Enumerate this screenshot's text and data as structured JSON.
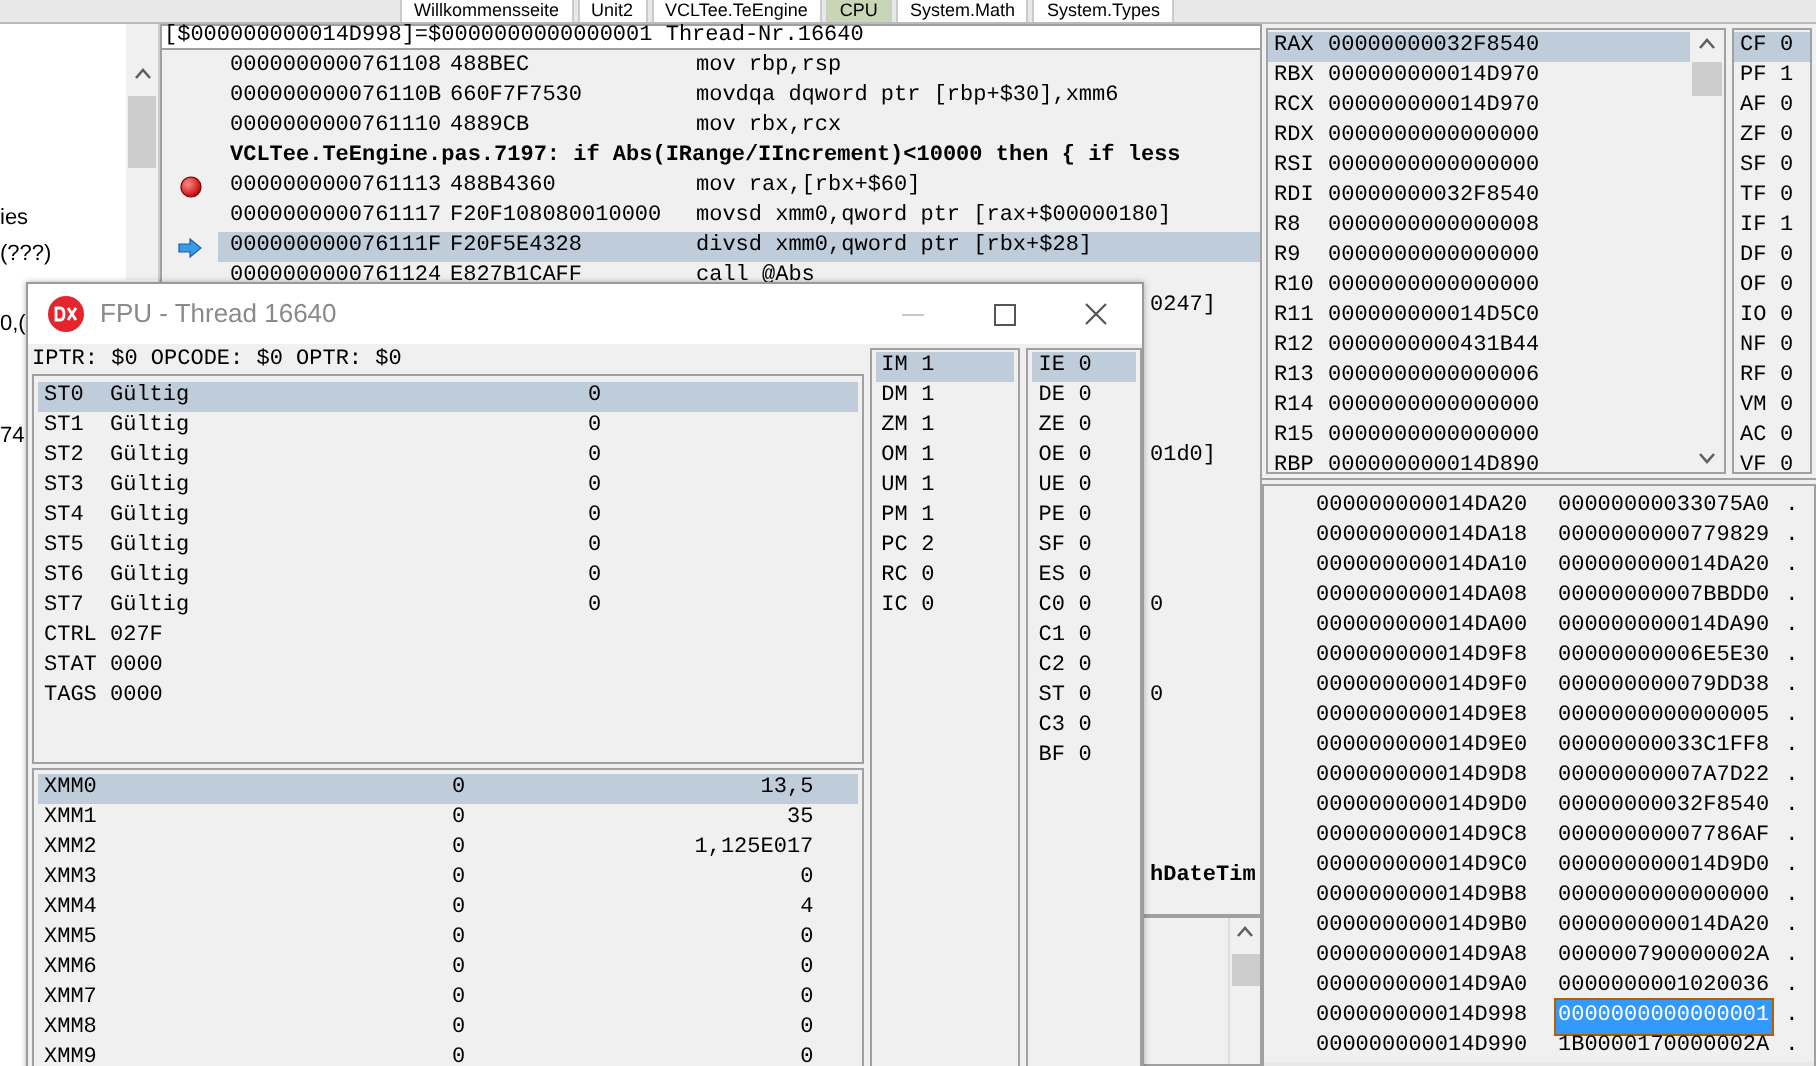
{
  "ide_tabs": [
    {
      "label": "Willkommensseite",
      "selected": false
    },
    {
      "label": "Unit2",
      "selected": false
    },
    {
      "label": "VCLTee.TeEngine",
      "selected": false
    },
    {
      "label": "CPU",
      "selected": true
    },
    {
      "label": "System.Math",
      "selected": false
    },
    {
      "label": "System.Types",
      "selected": false
    }
  ],
  "left_panel": {
    "fragments": [
      "ies",
      "(???)",
      "0,(",
      "74"
    ]
  },
  "disassembly": {
    "header": "[$000000000014D998]=$0000000000000001 Thread-Nr.16640",
    "rows": [
      {
        "kind": "code",
        "address": "0000000000761108",
        "bytes": "488BEC",
        "instruction": "mov rbp,rsp",
        "breakpoint": false,
        "current_line": false,
        "selected": false
      },
      {
        "kind": "code",
        "address": "000000000076110B",
        "bytes": "660F7F7530",
        "instruction": "movdqa dqword ptr [rbp+$30],xmm6",
        "breakpoint": false,
        "current_line": false,
        "selected": false
      },
      {
        "kind": "code",
        "address": "0000000000761110",
        "bytes": "4889CB",
        "instruction": "mov rbx,rcx",
        "breakpoint": false,
        "current_line": false,
        "selected": false
      },
      {
        "kind": "source",
        "text": "VCLTee.TeEngine.pas.7197: if Abs(IRange/IIncrement)<10000 then  { if less"
      },
      {
        "kind": "code",
        "address": "0000000000761113",
        "bytes": "488B4360",
        "instruction": "mov rax,[rbx+$60]",
        "breakpoint": true,
        "current_line": false,
        "selected": false
      },
      {
        "kind": "code",
        "address": "0000000000761117",
        "bytes": "F20F108080010000",
        "instruction": "movsd xmm0,qword ptr [rax+$00000180]",
        "breakpoint": false,
        "current_line": false,
        "selected": false
      },
      {
        "kind": "code",
        "address": "000000000076111F",
        "bytes": "F20F5E4328",
        "instruction": "divsd xmm0,qword ptr [rbx+$28]",
        "breakpoint": false,
        "current_line": true,
        "selected": true
      },
      {
        "kind": "code",
        "address": "0000000000761124",
        "bytes": "E827B1CAFF",
        "instruction": "call @Abs",
        "breakpoint": false,
        "current_line": false,
        "selected": false
      }
    ],
    "hidden_fragments": [
      {
        "kind": "code",
        "text": "0247]"
      },
      {
        "kind": "code",
        "text": "01d0]"
      },
      {
        "kind": "code",
        "text": "0"
      },
      {
        "kind": "code",
        "text": "0"
      },
      {
        "kind": "source",
        "text": "hDateTim"
      }
    ]
  },
  "registers": [
    {
      "name": "RAX",
      "value": "00000000032F8540",
      "selected": true
    },
    {
      "name": "RBX",
      "value": "000000000014D970",
      "selected": false
    },
    {
      "name": "RCX",
      "value": "000000000014D970",
      "selected": false
    },
    {
      "name": "RDX",
      "value": "0000000000000000",
      "selected": false
    },
    {
      "name": "RSI",
      "value": "0000000000000000",
      "selected": false
    },
    {
      "name": "RDI",
      "value": "00000000032F8540",
      "selected": false
    },
    {
      "name": "R8",
      "value": "0000000000000008",
      "selected": false
    },
    {
      "name": "R9",
      "value": "0000000000000000",
      "selected": false
    },
    {
      "name": "R10",
      "value": "0000000000000000",
      "selected": false
    },
    {
      "name": "R11",
      "value": "000000000014D5C0",
      "selected": false
    },
    {
      "name": "R12",
      "value": "0000000000431B44",
      "selected": false
    },
    {
      "name": "R13",
      "value": "0000000000000006",
      "selected": false
    },
    {
      "name": "R14",
      "value": "0000000000000000",
      "selected": false
    },
    {
      "name": "R15",
      "value": "0000000000000000",
      "selected": false
    },
    {
      "name": "RBP",
      "value": "000000000014D890",
      "selected": false
    }
  ],
  "flags": [
    {
      "name": "CF",
      "value": "0",
      "selected": true
    },
    {
      "name": "PF",
      "value": "1",
      "selected": false
    },
    {
      "name": "AF",
      "value": "0",
      "selected": false
    },
    {
      "name": "ZF",
      "value": "0",
      "selected": false
    },
    {
      "name": "SF",
      "value": "0",
      "selected": false
    },
    {
      "name": "TF",
      "value": "0",
      "selected": false
    },
    {
      "name": "IF",
      "value": "1",
      "selected": false
    },
    {
      "name": "DF",
      "value": "0",
      "selected": false
    },
    {
      "name": "OF",
      "value": "0",
      "selected": false
    },
    {
      "name": "IO",
      "value": "0",
      "selected": false
    },
    {
      "name": "NF",
      "value": "0",
      "selected": false
    },
    {
      "name": "RF",
      "value": "0",
      "selected": false
    },
    {
      "name": "VM",
      "value": "0",
      "selected": false
    },
    {
      "name": "AC",
      "value": "0",
      "selected": false
    },
    {
      "name": "VF",
      "value": "0",
      "selected": false
    }
  ],
  "stack": [
    {
      "address": "000000000014DA20",
      "value": "00000000033075A0",
      "ascii": ".",
      "selected": false
    },
    {
      "address": "000000000014DA18",
      "value": "0000000000779829",
      "ascii": ".",
      "selected": false
    },
    {
      "address": "000000000014DA10",
      "value": "000000000014DA20",
      "ascii": ".",
      "selected": false
    },
    {
      "address": "000000000014DA08",
      "value": "00000000007BBDD0",
      "ascii": ".",
      "selected": false
    },
    {
      "address": "000000000014DA00",
      "value": "000000000014DA90",
      "ascii": ".",
      "selected": false
    },
    {
      "address": "000000000014D9F8",
      "value": "00000000006E5E30",
      "ascii": ".",
      "selected": false
    },
    {
      "address": "000000000014D9F0",
      "value": "000000000079DD38",
      "ascii": ".",
      "selected": false
    },
    {
      "address": "000000000014D9E8",
      "value": "0000000000000005",
      "ascii": ".",
      "selected": false
    },
    {
      "address": "000000000014D9E0",
      "value": "00000000033C1FF8",
      "ascii": ".",
      "selected": false
    },
    {
      "address": "000000000014D9D8",
      "value": "00000000007A7D22",
      "ascii": ".",
      "selected": false
    },
    {
      "address": "000000000014D9D0",
      "value": "00000000032F8540",
      "ascii": ".",
      "selected": false
    },
    {
      "address": "000000000014D9C8",
      "value": "00000000007786AF",
      "ascii": ".",
      "selected": false
    },
    {
      "address": "000000000014D9C0",
      "value": "000000000014D9D0",
      "ascii": ".",
      "selected": false
    },
    {
      "address": "000000000014D9B8",
      "value": "0000000000000000",
      "ascii": ".",
      "selected": false
    },
    {
      "address": "000000000014D9B0",
      "value": "000000000014DA20",
      "ascii": ".",
      "selected": false
    },
    {
      "address": "000000000014D9A8",
      "value": "000000790000002A",
      "ascii": ".",
      "selected": false
    },
    {
      "address": "000000000014D9A0",
      "value": "0000000001020036",
      "ascii": ".",
      "selected": false
    },
    {
      "address": "000000000014D998",
      "value": "0000000000000001",
      "ascii": ".",
      "selected": true
    },
    {
      "address": "000000000014D990",
      "value": "1B0000170000002A",
      "ascii": ".",
      "selected": false
    }
  ],
  "fpu_window": {
    "title": "FPU - Thread 16640",
    "info": "IPTR: $0 OPCODE: $0 OPTR: $0",
    "st_registers": [
      {
        "name": "ST0",
        "status": "Gültig",
        "value": "0",
        "selected": true
      },
      {
        "name": "ST1",
        "status": "Gültig",
        "value": "0",
        "selected": false
      },
      {
        "name": "ST2",
        "status": "Gültig",
        "value": "0",
        "selected": false
      },
      {
        "name": "ST3",
        "status": "Gültig",
        "value": "0",
        "selected": false
      },
      {
        "name": "ST4",
        "status": "Gültig",
        "value": "0",
        "selected": false
      },
      {
        "name": "ST5",
        "status": "Gültig",
        "value": "0",
        "selected": false
      },
      {
        "name": "ST6",
        "status": "Gültig",
        "value": "0",
        "selected": false
      },
      {
        "name": "ST7",
        "status": "Gültig",
        "value": "0",
        "selected": false
      }
    ],
    "words": [
      {
        "name": "CTRL",
        "value": "027F"
      },
      {
        "name": "STAT",
        "value": "0000"
      },
      {
        "name": "TAGS",
        "value": "0000"
      }
    ],
    "xmm": [
      {
        "name": "XMM0",
        "column_2": "0",
        "column_3": "13,5",
        "selected": true
      },
      {
        "name": "XMM1",
        "column_2": "0",
        "column_3": "35",
        "selected": false
      },
      {
        "name": "XMM2",
        "column_2": "0",
        "column_3": "1,125E017",
        "selected": false
      },
      {
        "name": "XMM3",
        "column_2": "0",
        "column_3": "0",
        "selected": false
      },
      {
        "name": "XMM4",
        "column_2": "0",
        "column_3": "4",
        "selected": false
      },
      {
        "name": "XMM5",
        "column_2": "0",
        "column_3": "0",
        "selected": false
      },
      {
        "name": "XMM6",
        "column_2": "0",
        "column_3": "0",
        "selected": false
      },
      {
        "name": "XMM7",
        "column_2": "0",
        "column_3": "0",
        "selected": false
      },
      {
        "name": "XMM8",
        "column_2": "0",
        "column_3": "0",
        "selected": false
      },
      {
        "name": "XMM9",
        "column_2": "0",
        "column_3": "0",
        "selected": false
      }
    ],
    "control_flags": [
      {
        "name": "IM",
        "value": "1",
        "selected": true
      },
      {
        "name": "DM",
        "value": "1",
        "selected": false
      },
      {
        "name": "ZM",
        "value": "1",
        "selected": false
      },
      {
        "name": "OM",
        "value": "1",
        "selected": false
      },
      {
        "name": "UM",
        "value": "1",
        "selected": false
      },
      {
        "name": "PM",
        "value": "1",
        "selected": false
      },
      {
        "name": "PC",
        "value": "2",
        "selected": false
      },
      {
        "name": "RC",
        "value": "0",
        "selected": false
      },
      {
        "name": "IC",
        "value": "0",
        "selected": false
      }
    ],
    "status_flags": [
      {
        "name": "IE",
        "value": "0",
        "selected": true
      },
      {
        "name": "DE",
        "value": "0",
        "selected": false
      },
      {
        "name": "ZE",
        "value": "0",
        "selected": false
      },
      {
        "name": "OE",
        "value": "0",
        "selected": false
      },
      {
        "name": "UE",
        "value": "0",
        "selected": false
      },
      {
        "name": "PE",
        "value": "0",
        "selected": false
      },
      {
        "name": "SF",
        "value": "0",
        "selected": false
      },
      {
        "name": "ES",
        "value": "0",
        "selected": false
      },
      {
        "name": "C0",
        "value": "0",
        "selected": false
      },
      {
        "name": "C1",
        "value": "0",
        "selected": false
      },
      {
        "name": "C2",
        "value": "0",
        "selected": false
      },
      {
        "name": "ST",
        "value": "0",
        "selected": false
      },
      {
        "name": "C3",
        "value": "0",
        "selected": false
      },
      {
        "name": "BF",
        "value": "0",
        "selected": false
      }
    ]
  }
}
